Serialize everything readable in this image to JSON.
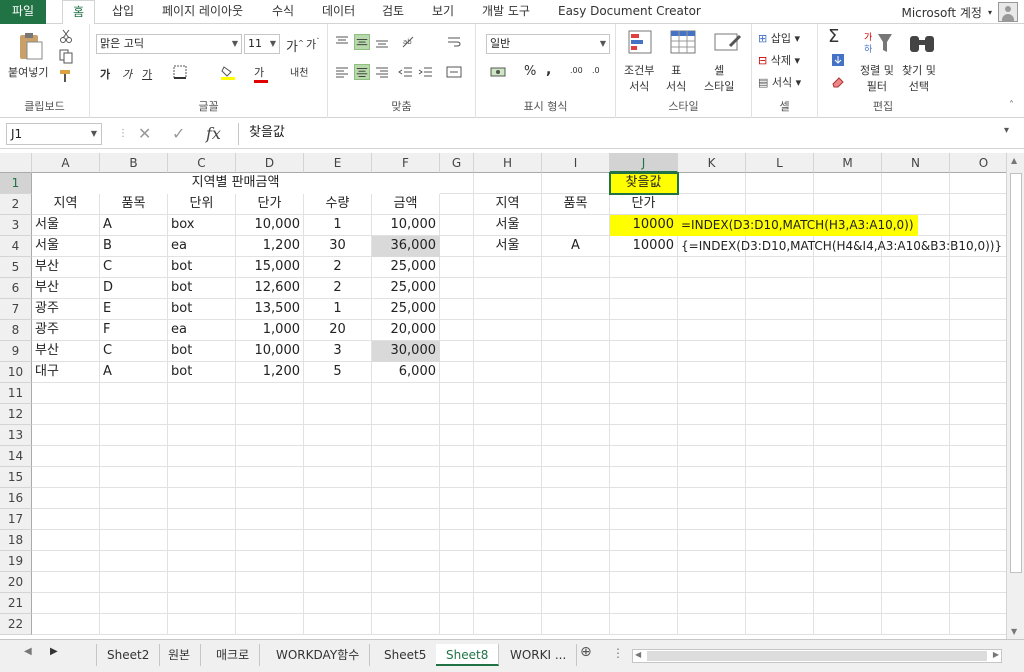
{
  "tabs": {
    "file": "파일",
    "items": [
      "홈",
      "삽입",
      "페이지 레이아웃",
      "수식",
      "데이터",
      "검토",
      "보기",
      "개발 도구",
      "Easy Document Creator"
    ],
    "account": "Microsoft 계정"
  },
  "ribbon": {
    "clipboard": {
      "paste": "붙여넣기",
      "label": "클립보드"
    },
    "font": {
      "name": "맑은 고딕",
      "size": "11",
      "bold": "가",
      "italic": "가",
      "underline": "가",
      "color_a": "가",
      "phonetic": "내천",
      "label": "글꼴"
    },
    "align": {
      "label": "맞춤"
    },
    "number": {
      "format": "일반",
      "percent": "%",
      "comma": ",",
      "label": "표시 형식"
    },
    "styles": {
      "cond": "조건부",
      "cond2": "서식",
      "table": "표",
      "table2": "서식",
      "cell": "셀",
      "cell2": "스타일",
      "label": "스타일"
    },
    "cells": {
      "insert": "삽입",
      "delete": "삭제",
      "format": "서식",
      "label": "셀"
    },
    "editing": {
      "sort": "정렬 및",
      "sort2": "필터",
      "find": "찾기 및",
      "find2": "선택",
      "label": "편집"
    }
  },
  "formula_bar": {
    "name_box": "J1",
    "content": "찾을값",
    "cancel": "✕",
    "enter": "✓",
    "fx": "fx"
  },
  "columns": [
    "A",
    "B",
    "C",
    "D",
    "E",
    "F",
    "G",
    "H",
    "I",
    "J",
    "K",
    "L",
    "M",
    "N",
    "O"
  ],
  "rows": [
    "1",
    "2",
    "3",
    "4",
    "5",
    "6",
    "7",
    "8",
    "9",
    "10",
    "11",
    "12",
    "13",
    "14",
    "15",
    "16",
    "17",
    "18",
    "19",
    "20",
    "21",
    "22"
  ],
  "sheet": {
    "title": "지역별 판매금액",
    "headers": [
      "지역",
      "품목",
      "단위",
      "단가",
      "수량",
      "금액"
    ],
    "data": [
      [
        "서울",
        "A",
        "box",
        "10,000",
        "1",
        "10,000"
      ],
      [
        "서울",
        "B",
        "ea",
        "1,200",
        "30",
        "36,000"
      ],
      [
        "부산",
        "C",
        "bot",
        "15,000",
        "2",
        "25,000"
      ],
      [
        "부산",
        "D",
        "bot",
        "12,600",
        "2",
        "25,000"
      ],
      [
        "광주",
        "E",
        "bot",
        "13,500",
        "1",
        "25,000"
      ],
      [
        "광주",
        "F",
        "ea",
        "1,000",
        "20",
        "20,000"
      ],
      [
        "부산",
        "C",
        "bot",
        "10,000",
        "3",
        "30,000"
      ],
      [
        "대구",
        "A",
        "bot",
        "1,200",
        "5",
        "6,000"
      ]
    ],
    "lookup": {
      "j1": "찾을값",
      "h2": "지역",
      "i2": "품목",
      "j2": "단가",
      "h3": "서울",
      "j3": "10000",
      "k3": "=INDEX(D3:D10,MATCH(H3,A3:A10,0))",
      "h4": "서울",
      "i4": "A",
      "j4": "10000",
      "k4": "{=INDEX(D3:D10,MATCH(H4&I4,A3:A10&B3:B10,0))}"
    }
  },
  "sheet_tabs": [
    "Sheet2",
    "원본",
    "매크로",
    "WORKDAY함수",
    "Sheet5",
    "Sheet8",
    "WORKI ..."
  ],
  "active_sheet": "Sheet8",
  "colors": {
    "accent": "#217346",
    "highlight": "#ffff00",
    "gray_fill": "#d9d9d9"
  }
}
